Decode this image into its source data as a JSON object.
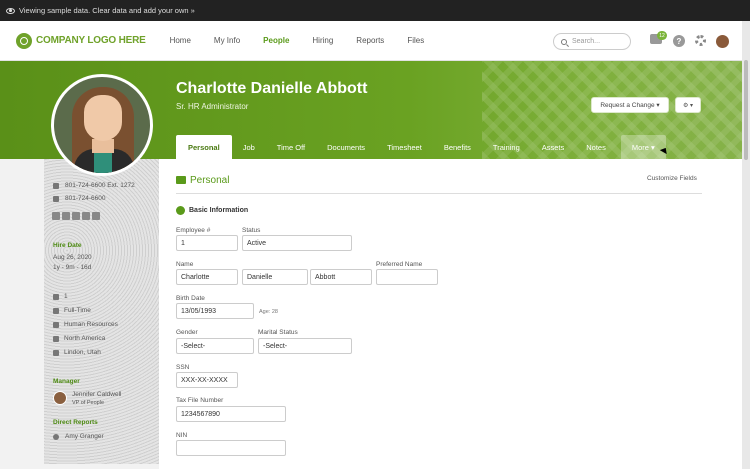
{
  "banner": {
    "text": "Viewing sample data. Clear data and add your own »"
  },
  "header": {
    "logo_text": "COMPANY LOGO HERE",
    "nav": [
      "Home",
      "My Info",
      "People",
      "Hiring",
      "Reports",
      "Files"
    ],
    "active_nav": "People",
    "search_placeholder": "Search...",
    "inbox_count": "12",
    "help_glyph": "?"
  },
  "profile": {
    "name": "Charlotte Danielle Abbott",
    "title": "Sr. HR Administrator",
    "request_button": "Request a Change ▾",
    "settings_button": "⚙ ▾"
  },
  "tabs": [
    "Personal",
    "Job",
    "Time Off",
    "Documents",
    "Timesheet",
    "Benefits",
    "Training",
    "Assets",
    "Notes",
    "More ▾"
  ],
  "active_tab": "Personal",
  "sidebar": {
    "work_phone": "801-724-6600   Ext. 1272",
    "mobile_phone": "801-724-6600",
    "hire_date_label": "Hire Date",
    "hire_date": "Aug 26, 2020",
    "tenure": "1y - 9m - 16d",
    "employee_number": "1",
    "employment_status": "Full-Time",
    "department": "Human Resources",
    "division": "North America",
    "location": "Lindon, Utah",
    "manager_label": "Manager",
    "manager_name": "Jennifer Caldwell",
    "manager_title": "VP of People",
    "direct_reports_label": "Direct Reports",
    "direct_report": "Amy Granger"
  },
  "section": {
    "title": "Personal",
    "customize": "Customize Fields",
    "basic_info": "Basic Information"
  },
  "form": {
    "employee_id_label": "Employee #",
    "employee_id": "1",
    "status_label": "Status",
    "status": "Active",
    "name_label": "Name",
    "first_name": "Charlotte",
    "middle_name": "Danielle",
    "last_name": "Abbott",
    "preferred_name_label": "Preferred Name",
    "preferred_name": "",
    "birth_date_label": "Birth Date",
    "birth_date": "13/05/1993",
    "age_hint": "Age: 28",
    "gender_label": "Gender",
    "gender": "-Select-",
    "marital_label": "Marital Status",
    "marital": "-Select-",
    "ssn_label": "SSN",
    "ssn": "XXX-XX-XXXX",
    "tax_label": "Tax File Number",
    "tax": "1234567890",
    "nin_label": "NIN",
    "nin": ""
  },
  "colors": {
    "brand_green": "#6fa22a",
    "accent": "#5a9a1a"
  }
}
